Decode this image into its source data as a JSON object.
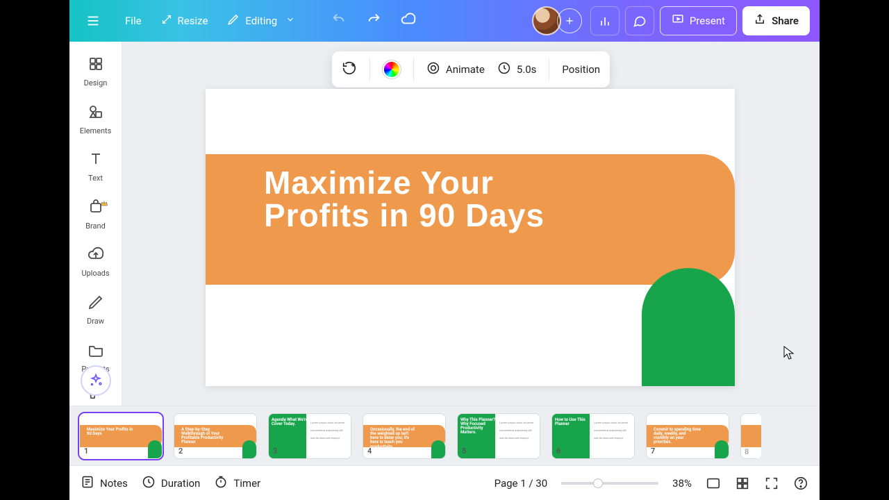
{
  "topbar": {
    "file": "File",
    "resize": "Resize",
    "mode": "Editing",
    "present": "Present",
    "share": "Share"
  },
  "rail": {
    "items": [
      {
        "label": "Design"
      },
      {
        "label": "Elements"
      },
      {
        "label": "Text"
      },
      {
        "label": "Brand"
      },
      {
        "label": "Uploads"
      },
      {
        "label": "Draw"
      },
      {
        "label": "Projects"
      }
    ]
  },
  "float": {
    "animate": "Animate",
    "duration": "5.0s",
    "position": "Position"
  },
  "slide": {
    "title": "Maximize Your Profits in 90 Days"
  },
  "thumbs": [
    {
      "n": "1",
      "title": "Maximize Your Profits in 90 Days",
      "layout": "A",
      "sel": true
    },
    {
      "n": "2",
      "title": "A Step-by-Step Walkthrough of Your Profitable Productivity Planner",
      "layout": "A"
    },
    {
      "n": "3",
      "title": "Agenda What We're Cover Today.",
      "layout": "B"
    },
    {
      "n": "4",
      "title": "Occasionally, the end of the weighted up isn't here to deter you; it's here to teach you productivity.",
      "layout": "A"
    },
    {
      "n": "5",
      "title": "Why This Planner? Why Focused Productivity Matters.",
      "layout": "B"
    },
    {
      "n": "6",
      "title": "How to Use This Planner",
      "layout": "B"
    },
    {
      "n": "7",
      "title": "Commit to spending time daily, weekly, and monthly on your priorities.",
      "layout": "A"
    },
    {
      "n": "8",
      "title": "",
      "layout": "half"
    }
  ],
  "bottom": {
    "notes": "Notes",
    "duration": "Duration",
    "timer": "Timer",
    "page": "Page 1 / 30",
    "zoom": "38%"
  }
}
